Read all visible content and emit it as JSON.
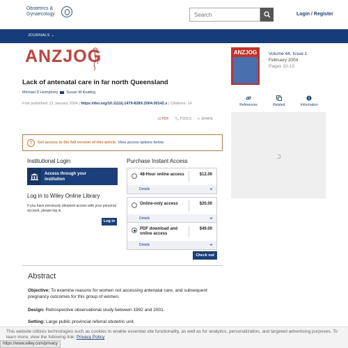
{
  "header": {
    "logo_line1": "Obstetrics &",
    "logo_line2": "Gynaecology",
    "search_placeholder": "Search",
    "login_label": "Login / Register"
  },
  "nav": {
    "journals_label": "JOURNALS"
  },
  "journal": {
    "brand": "ANZJOG",
    "cover_title": "ANZJOG",
    "volume_issue": "Volume 44, Issue 1",
    "date": "February 2004",
    "pages": "Pages 10-13"
  },
  "article": {
    "title": "Lack of antenatal care in far north Queensland",
    "author1": "Michael D Humphrey",
    "author2": "Susan M Keating",
    "first_published_label": "First published:",
    "first_published_date": "21 January 2004",
    "doi": "https://doi.org/10.1111/j.1479-828X.2004.00142.x",
    "citations": "Citations: 14"
  },
  "side_tabs": [
    {
      "label": "References",
      "icon": "link-icon"
    },
    {
      "label": "Related",
      "icon": "related-icon"
    },
    {
      "label": "Information",
      "icon": "info-icon"
    }
  ],
  "tools": {
    "pdf": "PDF",
    "tools": "TOOLS",
    "share": "SHARE"
  },
  "access": {
    "text": "Get access to the full version of this article.",
    "link": "View access options below."
  },
  "institutional": {
    "heading": "Institutional Login",
    "button": "Access through your institution",
    "wol_heading": "Log in to Wiley Online Library",
    "wol_text": "If you have previously obtained access with your personal account, please log in.",
    "login_button": "Log in"
  },
  "purchase": {
    "heading": "Purchase Instant Access",
    "options": [
      {
        "label": "48-Hour online access",
        "price": "$12.00",
        "details": "Details",
        "selected": false
      },
      {
        "label": "Online-only access",
        "price": "$20.00",
        "details": "Details",
        "selected": false
      },
      {
        "label": "PDF download and online access",
        "price": "$49.00",
        "details": "Details",
        "selected": true
      }
    ],
    "checkout": "Check out"
  },
  "abstract": {
    "heading": "Abstract",
    "objective_label": "Objective:",
    "objective_text": "To examine reasons for women not accessing antenatal care, and subsequent pregnancy outcomes for this group of women.",
    "design_label": "Design:",
    "design_text": "Retrospective observational study between 1992 and 2001.",
    "setting_label": "Setting:",
    "setting_text": "Large public provincial referral obstetric unit."
  },
  "cookie": {
    "text": "This website utilizes technologies such as cookies to enable essential site functionality, as well as for analytics, personalization, and targeted advertising purposes. To learn more, view the following link:",
    "link": "Privacy Policy"
  },
  "status_url": "https://www.wiley.com/privacy",
  "colors": {
    "brand_blue": "#163c7a",
    "anzjog_red": "#c8403a",
    "access_orange": "#e0752a"
  }
}
